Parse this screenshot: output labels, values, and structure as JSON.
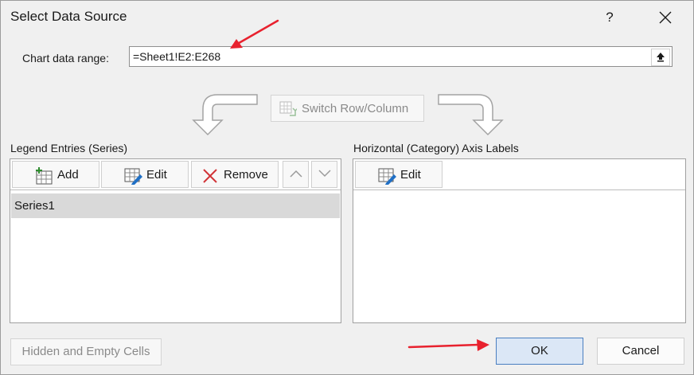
{
  "dialog": {
    "title": "Select Data Source",
    "help_label": "?",
    "close_icon": "close-icon"
  },
  "chart_range": {
    "label": "Chart data range:",
    "value": "=Sheet1!E2:E268",
    "collapse_icon": "collapse-dialog-icon"
  },
  "switch_button": {
    "label": "Switch Row/Column",
    "icon": "switch-row-column-icon",
    "enabled": false
  },
  "legend_panel": {
    "label": "Legend Entries (Series)",
    "buttons": {
      "add": "Add",
      "edit": "Edit",
      "remove": "Remove"
    },
    "series": [
      "Series1"
    ]
  },
  "axis_panel": {
    "label": "Horizontal (Category) Axis Labels",
    "buttons": {
      "edit": "Edit"
    }
  },
  "footer": {
    "hidden_cells_label": "Hidden and Empty Cells",
    "ok_label": "OK",
    "cancel_label": "Cancel"
  },
  "colors": {
    "annotation_arrow": "#e8212e",
    "ok_border": "#4a7fc0",
    "ok_fill": "#dbe7f6",
    "selected_row": "#d9d9d9",
    "remove_icon": "#d13438",
    "add_icon": "#2e8b2e",
    "edit_pencil": "#1f6fc5"
  }
}
